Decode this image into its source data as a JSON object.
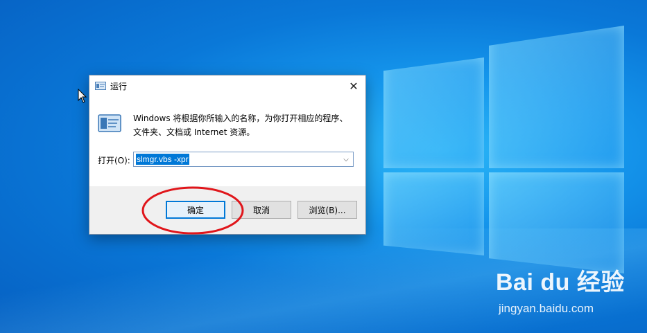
{
  "dialog": {
    "title": "运行",
    "description_line1": "Windows 将根据你所输入的名称，为你打开相应的程序、",
    "description_line2": "文件夹、文档或 Internet 资源。",
    "open_label": "打开(O):",
    "input_value": "slmgr.vbs -xpr",
    "buttons": {
      "ok": "确定",
      "cancel": "取消",
      "browse": "浏览(B)..."
    }
  },
  "watermark": {
    "brand": "Bai du 经验",
    "url": "jingyan.baidu.com"
  },
  "colors": {
    "accent": "#0078d7",
    "annotation": "#e0161b"
  }
}
